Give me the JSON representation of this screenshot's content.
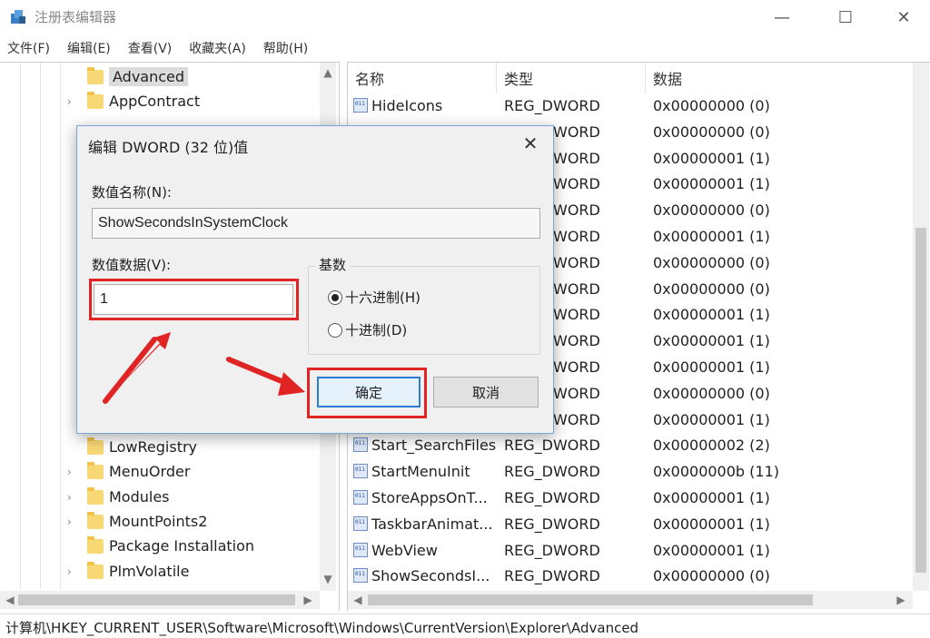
{
  "window": {
    "title": "注册表编辑器",
    "minimize_label": "—",
    "maximize_label": "☐",
    "close_label": "✕"
  },
  "menu": [
    "文件(F)",
    "编辑(E)",
    "查看(V)",
    "收藏夹(A)",
    "帮助(H)"
  ],
  "tree": {
    "items": [
      {
        "label": "Advanced",
        "selected": true
      },
      {
        "label": "AppContract"
      },
      {
        "label": "LowRegistry"
      },
      {
        "label": "MenuOrder"
      },
      {
        "label": "Modules"
      },
      {
        "label": "MountPoints2"
      },
      {
        "label": "Package Installation"
      },
      {
        "label": "PlmVolatile"
      }
    ]
  },
  "values_list": {
    "headers": {
      "name": "名称",
      "type": "类型",
      "data": "数据"
    },
    "rows": [
      {
        "name": "HideIcons",
        "type": "REG_DWORD",
        "data": "0x00000000 (0)"
      },
      {
        "name": "",
        "type": "WORD",
        "data": "0x00000000 (0)"
      },
      {
        "name": "",
        "type": "WORD",
        "data": "0x00000001 (1)"
      },
      {
        "name": "",
        "type": "WORD",
        "data": "0x00000001 (1)"
      },
      {
        "name": "",
        "type": "WORD",
        "data": "0x00000000 (0)"
      },
      {
        "name": "",
        "type": "WORD",
        "data": "0x00000001 (1)"
      },
      {
        "name": "",
        "type": "WORD",
        "data": "0x00000000 (0)"
      },
      {
        "name": "",
        "type": "WORD",
        "data": "0x00000000 (0)"
      },
      {
        "name": "",
        "type": "WORD",
        "data": "0x00000001 (1)"
      },
      {
        "name": "",
        "type": "WORD",
        "data": "0x00000001 (1)"
      },
      {
        "name": "",
        "type": "WORD",
        "data": "0x00000001 (1)"
      },
      {
        "name": "",
        "type": "WORD",
        "data": "0x00000000 (0)"
      },
      {
        "name": "",
        "type": "WORD",
        "data": "0x00000001 (1)"
      },
      {
        "name": "Start_SearchFiles",
        "type": "REG_DWORD",
        "data": "0x00000002 (2)"
      },
      {
        "name": "StartMenuInit",
        "type": "REG_DWORD",
        "data": "0x0000000b (11)"
      },
      {
        "name": "StoreAppsOnT...",
        "type": "REG_DWORD",
        "data": "0x00000001 (1)"
      },
      {
        "name": "TaskbarAnimat...",
        "type": "REG_DWORD",
        "data": "0x00000001 (1)"
      },
      {
        "name": "WebView",
        "type": "REG_DWORD",
        "data": "0x00000001 (1)"
      },
      {
        "name": "ShowSecondsI...",
        "type": "REG_DWORD",
        "data": "0x00000000 (0)"
      }
    ]
  },
  "status_path": "计算机\\HKEY_CURRENT_USER\\Software\\Microsoft\\Windows\\CurrentVersion\\Explorer\\Advanced",
  "dialog": {
    "title": "编辑 DWORD (32 位)值",
    "close_label": "✕",
    "value_name_label": "数值名称(N):",
    "value_name": "ShowSecondsInSystemClock",
    "value_data_label": "数值数据(V):",
    "value_data": "1",
    "base_label": "基数",
    "radio_hex": "十六进制(H)",
    "radio_dec": "十进制(D)",
    "ok_label": "确定",
    "cancel_label": "取消"
  },
  "colors": {
    "highlight": "#e02424",
    "primary_button_border": "#2e7bd3"
  }
}
